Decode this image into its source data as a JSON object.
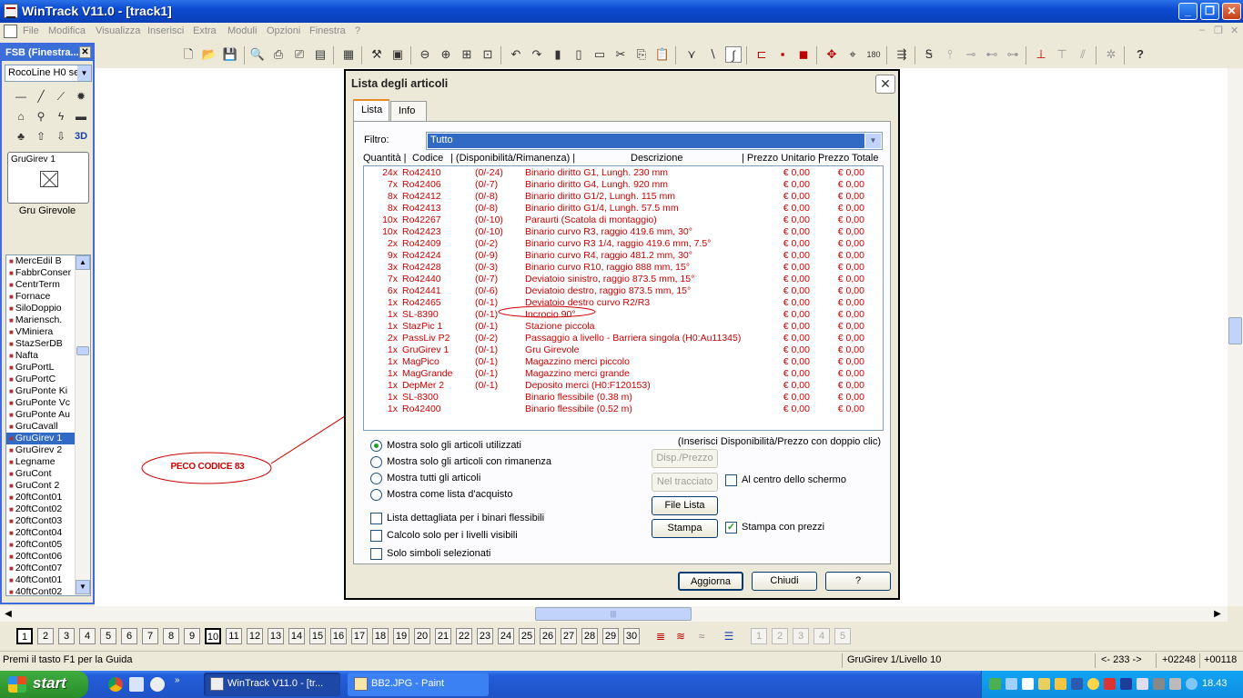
{
  "window": {
    "title": "WinTrack  V11.0 - [track1]",
    "min": "_",
    "max": "❐",
    "close": "✕"
  },
  "menu": [
    "File",
    "Modifica",
    "Visualizza",
    "Inserisci",
    "Extra",
    "Moduli",
    "Opzioni",
    "Finestra",
    "?"
  ],
  "mdi_controls": [
    "–",
    "❐",
    "✕"
  ],
  "left_panel": {
    "title": "FSB (Finestra...",
    "selector": "RocoLine H0 se",
    "preview_label": "GruGirev 1",
    "preview_caption": "Gru Girevole",
    "items": [
      "MercEdil B",
      "FabbrConser",
      "CentrTerm",
      "Fornace",
      "SiloDoppio",
      "Mariensch.",
      "VMiniera",
      "StazSerDB",
      "Nafta",
      "GruPortL",
      "GruPortC",
      "GruPonte Ki",
      "GruPonte Vc",
      "GruPonte Au",
      "GruCavall",
      "GruGirev 1",
      "GruGirev 2",
      "Legname",
      "GruCont",
      "GruCont 2",
      "20ftCont01",
      "20ftCont02",
      "20ftCont03",
      "20ftCont04",
      "20ftCont05",
      "20ftCont06",
      "20ftCont07",
      "40ftCont01",
      "40ftCont02"
    ],
    "selected_item": "GruGirev 1"
  },
  "annotation": {
    "label": "PECO CODICE 83"
  },
  "dialog": {
    "title": "Lista degli articoli",
    "tabs": [
      "Lista",
      "Info"
    ],
    "active_tab": "Lista",
    "filter_label": "Filtro:",
    "filter_value": "Tutto",
    "columns": {
      "qty": "Quantità |",
      "code": "Codice",
      "avail": "| (Disponibilità/Rimanenza) |",
      "desc": "Descrizione",
      "unit_price": "| Prezzo Unitario |",
      "total_price": "Prezzo Totale"
    },
    "rows": [
      {
        "qty": "24x",
        "code": "Ro42410",
        "avail": "(0/-24)",
        "desc": "Binario diritto G1, Lungh. 230 mm",
        "pu": "€ 0,00",
        "pt": "€ 0,00"
      },
      {
        "qty": "7x",
        "code": "Ro42406",
        "avail": "(0/-7)",
        "desc": "Binario diritto G4, Lungh. 920 mm",
        "pu": "€ 0,00",
        "pt": "€ 0,00"
      },
      {
        "qty": "8x",
        "code": "Ro42412",
        "avail": "(0/-8)",
        "desc": "Binario diritto G1/2, Lungh. 115 mm",
        "pu": "€ 0,00",
        "pt": "€ 0,00"
      },
      {
        "qty": "8x",
        "code": "Ro42413",
        "avail": "(0/-8)",
        "desc": "Binario diritto G1/4, Lungh. 57.5 mm",
        "pu": "€ 0,00",
        "pt": "€ 0,00"
      },
      {
        "qty": "10x",
        "code": "Ro42267",
        "avail": "(0/-10)",
        "desc": "Paraurti (Scatola di montaggio)",
        "pu": "€ 0,00",
        "pt": "€ 0,00"
      },
      {
        "qty": "10x",
        "code": "Ro42423",
        "avail": "(0/-10)",
        "desc": "Binario curvo R3, raggio 419.6 mm, 30°",
        "pu": "€ 0,00",
        "pt": "€ 0,00"
      },
      {
        "qty": "2x",
        "code": "Ro42409",
        "avail": "(0/-2)",
        "desc": "Binario curvo R3 1/4, raggio 419.6 mm, 7.5°",
        "pu": "€ 0,00",
        "pt": "€ 0,00"
      },
      {
        "qty": "9x",
        "code": "Ro42424",
        "avail": "(0/-9)",
        "desc": "Binario curvo R4, raggio 481.2 mm, 30°",
        "pu": "€ 0,00",
        "pt": "€ 0,00"
      },
      {
        "qty": "3x",
        "code": "Ro42428",
        "avail": "(0/-3)",
        "desc": "Binario curvo R10, raggio 888 mm, 15°",
        "pu": "€ 0,00",
        "pt": "€ 0,00"
      },
      {
        "qty": "7x",
        "code": "Ro42440",
        "avail": "(0/-7)",
        "desc": "Deviatoio sinistro, raggio 873.5 mm, 15°",
        "pu": "€ 0,00",
        "pt": "€ 0,00"
      },
      {
        "qty": "6x",
        "code": "Ro42441",
        "avail": "(0/-6)",
        "desc": "Deviatoio destro, raggio 873.5 mm, 15°",
        "pu": "€ 0,00",
        "pt": "€ 0,00"
      },
      {
        "qty": "1x",
        "code": "Ro42465",
        "avail": "(0/-1)",
        "desc": "Deviatoio destro curvo R2/R3",
        "pu": "€ 0,00",
        "pt": "€ 0,00"
      },
      {
        "qty": "1x",
        "code": "SL-8390",
        "avail": "(0/-1)",
        "desc": "Incrocio 90°",
        "pu": "€ 0,00",
        "pt": "€ 0,00"
      },
      {
        "qty": "1x",
        "code": "StazPic 1",
        "avail": "(0/-1)",
        "desc": "Stazione piccola",
        "pu": "€ 0,00",
        "pt": "€ 0,00"
      },
      {
        "qty": "2x",
        "code": "PassLiv P2",
        "avail": "(0/-2)",
        "desc": "Passaggio a livello - Barriera singola (H0:Au11345)",
        "pu": "€ 0,00",
        "pt": "€ 0,00"
      },
      {
        "qty": "1x",
        "code": "GruGirev 1",
        "avail": "(0/-1)",
        "desc": "Gru Girevole",
        "pu": "€ 0,00",
        "pt": "€ 0,00"
      },
      {
        "qty": "1x",
        "code": "MagPico",
        "avail": "(0/-1)",
        "desc": "Magazzino merci piccolo",
        "pu": "€ 0,00",
        "pt": "€ 0,00"
      },
      {
        "qty": "1x",
        "code": "MagGrande",
        "avail": "(0/-1)",
        "desc": "Magazzino merci grande",
        "pu": "€ 0,00",
        "pt": "€ 0,00"
      },
      {
        "qty": "1x",
        "code": "DepMer 2",
        "avail": "(0/-1)",
        "desc": "Deposito merci (H0:F120153)",
        "pu": "€ 0,00",
        "pt": "€ 0,00"
      },
      {
        "qty": "1x",
        "code": "SL-8300",
        "avail": "",
        "desc": "Binario flessibile (0.38 m)",
        "pu": "€ 0,00",
        "pt": "€ 0,00"
      },
      {
        "qty": "1x",
        "code": "Ro42400",
        "avail": "",
        "desc": "Binario flessibile (0.52 m)",
        "pu": "€ 0,00",
        "pt": "€ 0,00"
      }
    ],
    "hint": "(Inserisci Disponibilità/Prezzo con doppio clic)",
    "radios": [
      {
        "label": "Mostra solo gli articoli utilizzati",
        "checked": true
      },
      {
        "label": "Mostra solo gli articoli con rimanenza",
        "checked": false
      },
      {
        "label": "Mostra tutti gli articoli",
        "checked": false
      },
      {
        "label": "Mostra come lista d'acquisto",
        "checked": false
      }
    ],
    "checks_left": [
      {
        "label": "Lista dettagliata per i binari flessibili",
        "checked": false
      },
      {
        "label": "Calcolo solo per i livelli visibili",
        "checked": false
      },
      {
        "label": "Solo simboli selezionati",
        "checked": false
      }
    ],
    "btn_disp": "Disp./Prezzo",
    "btn_tracciato": "Nel tracciato",
    "chk_centro": "Al centro dello schermo",
    "btn_filelista": "File Lista",
    "btn_stampa": "Stampa",
    "chk_prezzi": "Stampa con prezzi",
    "chk_prezzi_checked": true,
    "btn_aggiorna": "Aggiorna",
    "btn_chiudi": "Chiudi",
    "btn_help": "?"
  },
  "levels": [
    "1",
    "2",
    "3",
    "4",
    "5",
    "6",
    "7",
    "8",
    "9",
    "10",
    "11",
    "12",
    "13",
    "14",
    "15",
    "16",
    "17",
    "18",
    "19",
    "20",
    "21",
    "22",
    "23",
    "24",
    "25",
    "26",
    "27",
    "28",
    "29",
    "30"
  ],
  "levels_extra": [
    "1",
    "2",
    "3",
    "4",
    "5"
  ],
  "status": {
    "help": "Premi il tasto F1 per la Guida",
    "object": "GruGirev 1/Livello 10",
    "angle": "<- 233 ->",
    "x": "+02248",
    "y": "+00118"
  },
  "taskbar": {
    "start": "start",
    "items": [
      "WinTrack  V11.0 - [tr...",
      "BB2.JPG - Paint"
    ],
    "clock": "18.43"
  }
}
